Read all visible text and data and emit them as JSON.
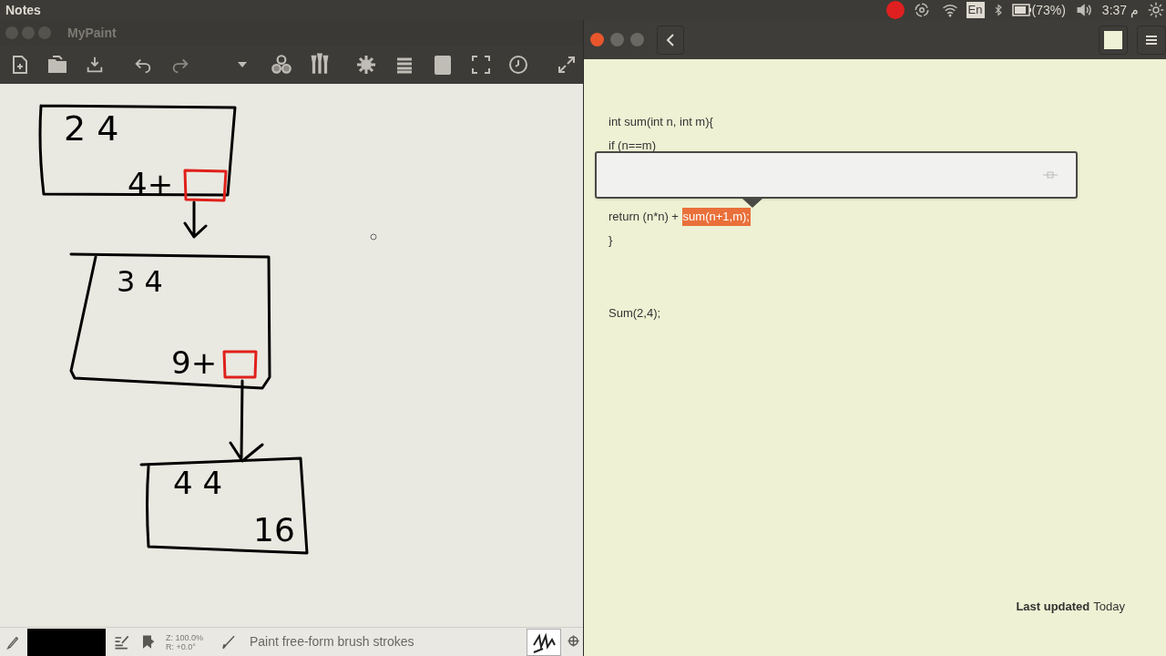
{
  "top_panel": {
    "app_title": "Notes",
    "keyboard_layout": "En",
    "battery": "(73%)",
    "clock": "م 3:37"
  },
  "mypaint": {
    "window_title": "MyPaint",
    "canvas_texts": [
      {
        "kind": "box1_top",
        "text": "2 4"
      },
      {
        "kind": "box1_bottom",
        "text": "4+"
      },
      {
        "kind": "box2_top",
        "text": "3 4"
      },
      {
        "kind": "box2_bottom",
        "text": "9+"
      },
      {
        "kind": "box3_top",
        "text": "4 4"
      },
      {
        "kind": "box3_bottom",
        "text": "16"
      }
    ],
    "status_bar": {
      "zoom": "Z: 100.0%",
      "rotation": "R: +0.0°",
      "tool_hint": "Paint free-form brush strokes"
    }
  },
  "notes": {
    "lines": [
      {
        "kind": "plain",
        "text": "int sum(int n, int m){"
      },
      {
        "kind": "plain",
        "text": "if (n==m)"
      },
      {
        "kind": "gap"
      },
      {
        "kind": "gap"
      },
      {
        "kind": "split",
        "text": "return (n*n) + ",
        "highlight": "sum(n+1,m);"
      },
      {
        "kind": "plain",
        "text": "}"
      },
      {
        "kind": "spacer"
      },
      {
        "kind": "plain",
        "text": "Sum(2,4);"
      }
    ],
    "footer": {
      "label": "Last updated",
      "value": "Today"
    }
  }
}
